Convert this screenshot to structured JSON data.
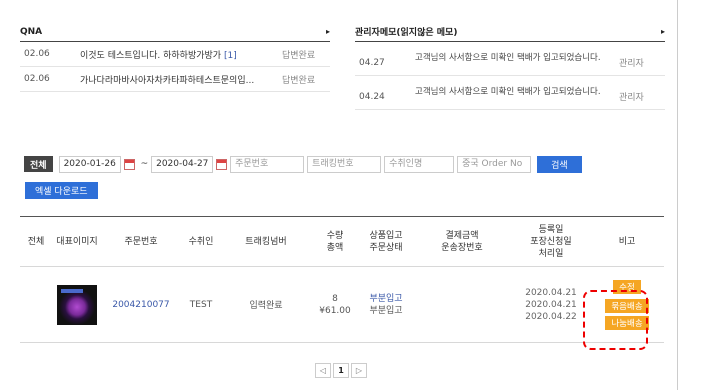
{
  "qna": {
    "title": "QNA",
    "arrow": "▸",
    "rows": [
      {
        "date": "02.06",
        "title": "이것도 테스트입니다. 하하하방가방가",
        "count": "[1]",
        "status": "답변완료"
      },
      {
        "date": "02.06",
        "title": "가나다라마바사아자차카타파하테스트문의입...",
        "count": "",
        "status": "답변완료"
      }
    ]
  },
  "memo": {
    "title": "관리자메모(읽지않은 메모)",
    "arrow": "▸",
    "rows": [
      {
        "date": "04.27",
        "text": "고객님의 사서함으로 미확인 택배가 입고되었습니다.",
        "author": "관리자"
      },
      {
        "date": "04.24",
        "text": "고객님의 사서함으로 미확인 택배가 입고되었습니다.",
        "author": "관리자"
      }
    ]
  },
  "search": {
    "all_label": "전체",
    "date_from": "2020-01-26",
    "date_to": "2020-04-27",
    "tilde": "~",
    "order_no_placeholder": "주문번호",
    "tracking_placeholder": "트래킹번호",
    "recipient_placeholder": "수취인명",
    "cn_order_placeholder": "중국 Order No",
    "search_label": "검색",
    "excel_label": "엑셀 다운로드"
  },
  "table": {
    "headers": {
      "all": "전체",
      "image": "대표이미지",
      "order_no": "주문번호",
      "recipient": "수취인",
      "tracking": "트래킹넘버",
      "qty_l1": "수량",
      "qty_l2": "총액",
      "status_l1": "상품입고",
      "status_l2": "주문상태",
      "pay_l1": "결제금액",
      "pay_l2": "운송장번호",
      "date_l1": "등록일",
      "date_l2": "포장신청일",
      "date_l3": "처리일",
      "note": "비고"
    },
    "rows": [
      {
        "order_no": "2004210077",
        "recipient": "TEST",
        "tracking": "입력완료",
        "qty": "8",
        "total": "¥61.00",
        "status1": "부분입고",
        "status2": "부분입고",
        "date1": "2020.04.21",
        "date2": "2020.04.21",
        "date3": "2020.04.22",
        "btn_edit": "수정",
        "btn_bundle": "묶음배송",
        "btn_split": "나눔배송"
      }
    ]
  },
  "pager": {
    "prev": "◁",
    "current": "1",
    "next": "▷"
  },
  "colors": {
    "accent": "#2e6fd8",
    "orange": "#f5a623",
    "highlight": "#e00000",
    "link": "#3a58a8"
  }
}
